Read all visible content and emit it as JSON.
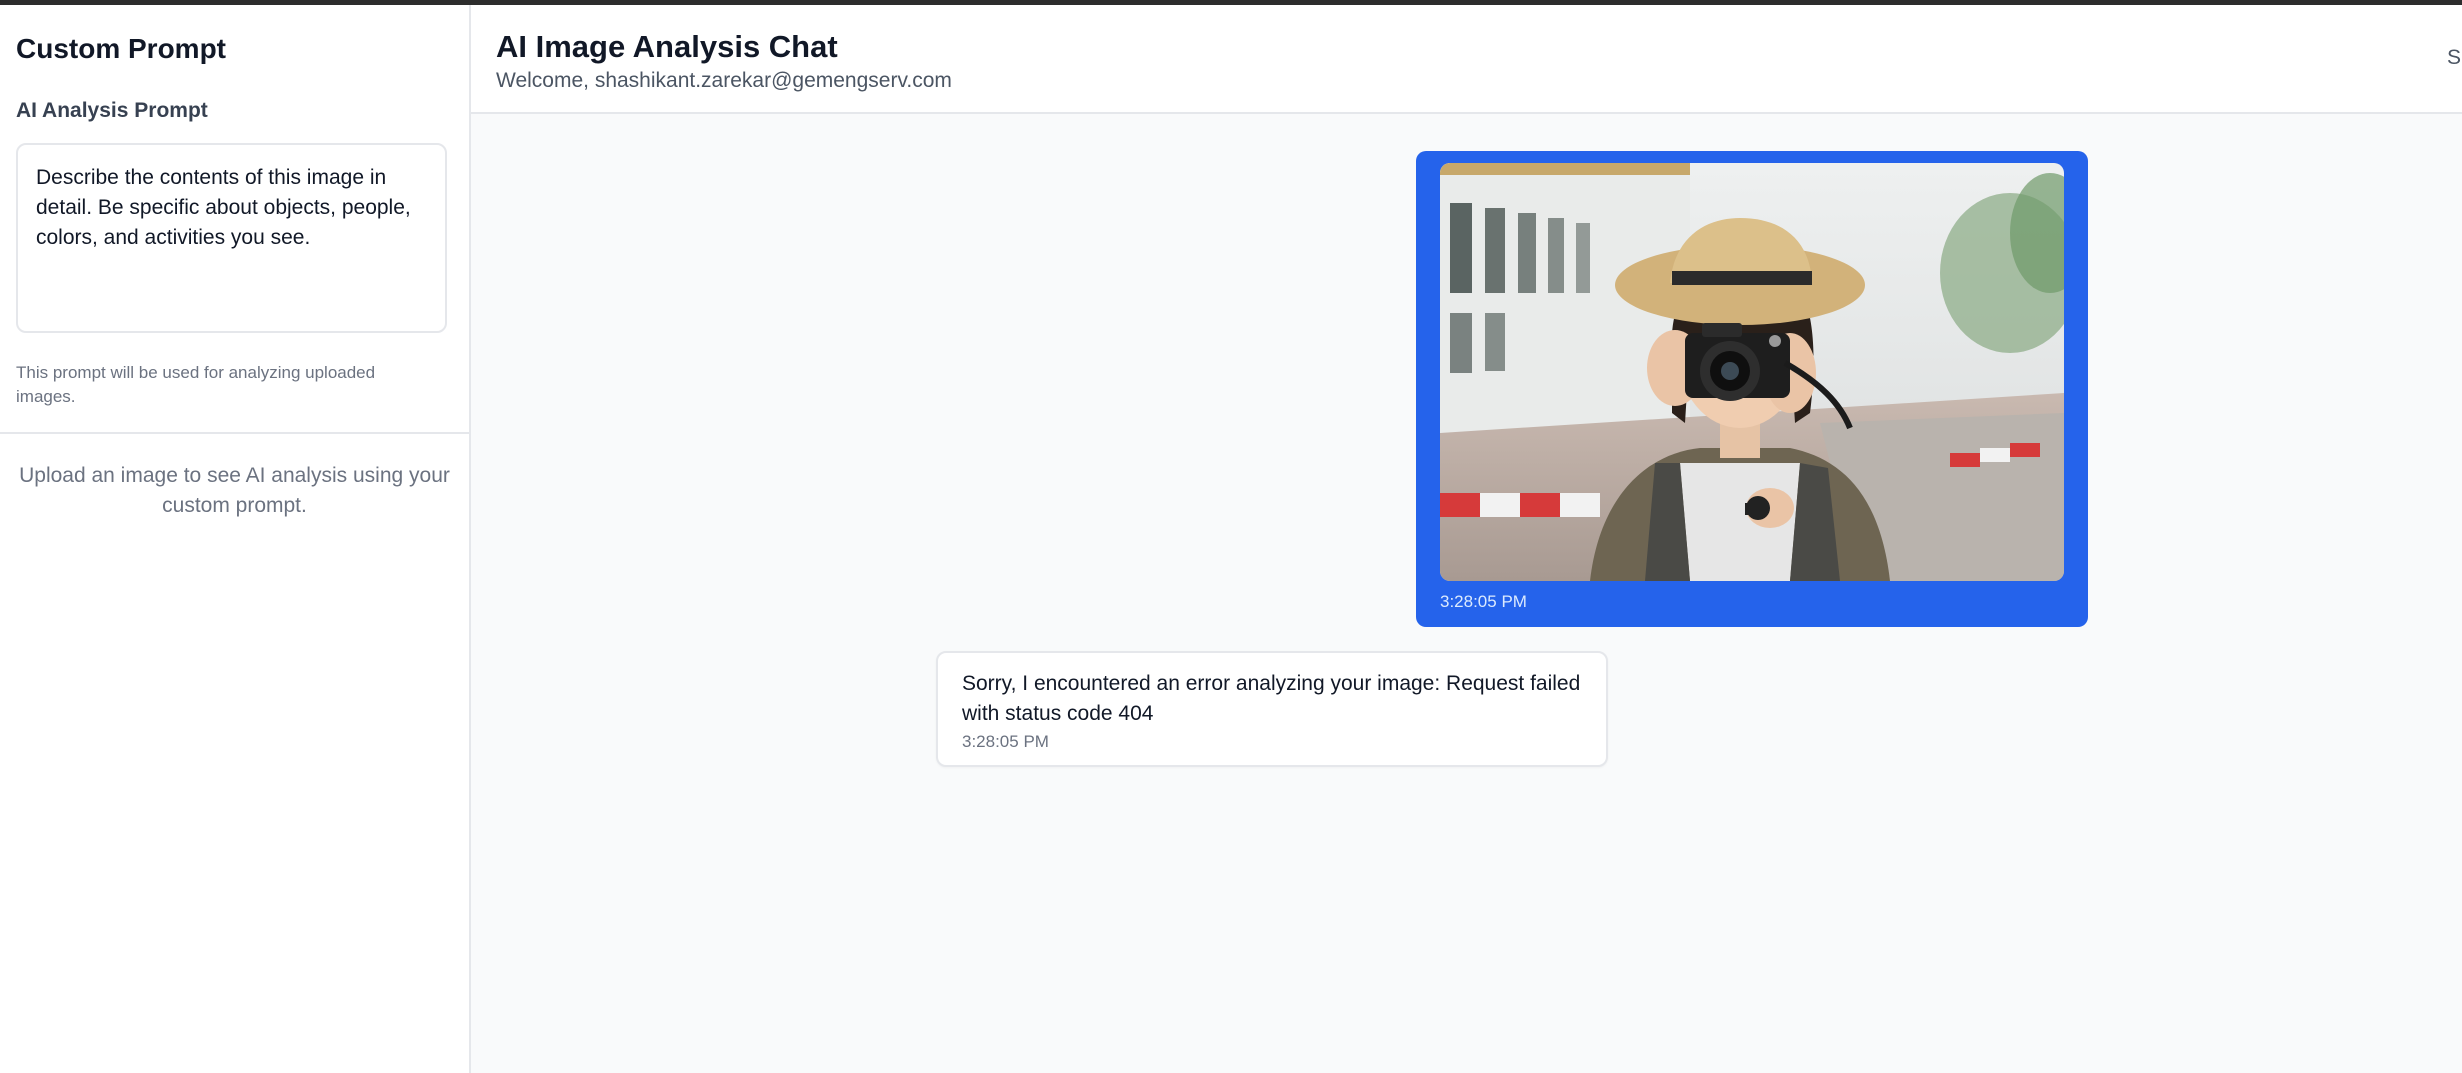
{
  "sidebar": {
    "title": "Custom Prompt",
    "prompt_label": "AI Analysis Prompt",
    "prompt_value": "Describe the contents of this image in detail. Be specific about objects, people, colors, and activities you see.",
    "prompt_help": "This prompt will be used for analyzing uploaded images.",
    "empty_state": "Upload an image to see AI analysis using your custom prompt."
  },
  "header": {
    "title": "AI Image Analysis Chat",
    "welcome_prefix": "Welcome, ",
    "email": "shashikant.zarekar@gemengserv.com",
    "signout_label": "Si"
  },
  "messages": [
    {
      "role": "user",
      "type": "image",
      "image_description": "photo of a woman in a straw hat taking a picture with a camera on a street",
      "time": "3:28:05 PM"
    },
    {
      "role": "assistant",
      "text": "Sorry, I encountered an error analyzing your image: Request failed with status code 404",
      "time": "3:28:05 PM"
    }
  ],
  "colors": {
    "accent": "#2563eb",
    "sidebar_border": "#e5e7eb",
    "chat_bg": "#f9fafb"
  }
}
